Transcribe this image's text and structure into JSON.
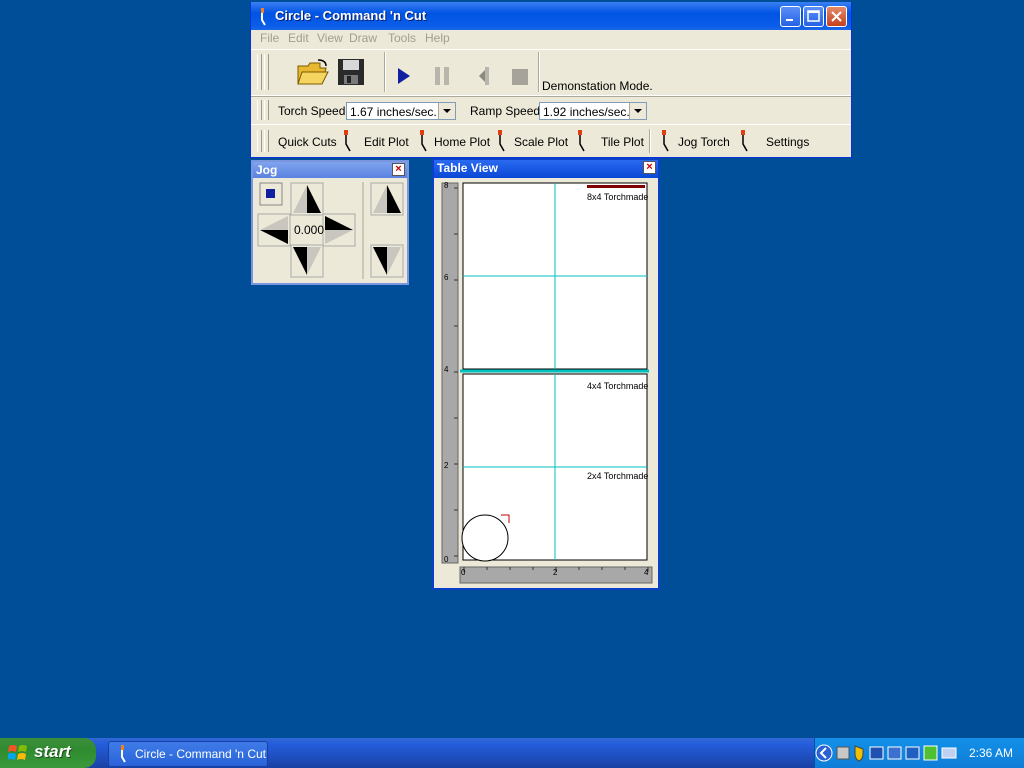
{
  "window": {
    "title": "Circle - Command 'n Cut"
  },
  "menu": [
    "File",
    "Edit",
    "View",
    "Draw",
    "Tools",
    "Help"
  ],
  "toolbar1": {
    "status_text": "Demonstation Mode.",
    "icons": [
      "open-folder-icon",
      "save-icon",
      "play-icon",
      "pause-icon",
      "step-back-icon",
      "stop-icon"
    ]
  },
  "toolbar2": {
    "torch_speed_label": "Torch Speed",
    "torch_speed_value": "1.67 inches/sec.",
    "ramp_speed_label": "Ramp Speed",
    "ramp_speed_value": "1.92 inches/sec."
  },
  "toolbar3": {
    "buttons": [
      "Quick Cuts",
      "Edit Plot",
      "Home Plot",
      "Scale Plot",
      "Tile Plot",
      "Jog Torch",
      "Settings"
    ]
  },
  "jog": {
    "title": "Jog",
    "value": "0.000"
  },
  "table_view": {
    "title": "Table View",
    "regions": [
      "8x4 Torchmade",
      "4x4 Torchmade",
      "2x4 Torchmade"
    ],
    "y_ticks": [
      "8",
      "6",
      "4",
      "2",
      "0"
    ],
    "x_ticks": [
      "0",
      "2",
      "4"
    ]
  },
  "taskbar": {
    "start_label": "start",
    "task_label": "Circle - Command 'n Cut",
    "clock": "2:36 AM"
  },
  "colors": {
    "desktop": "#004e98",
    "grid_line": "#00c0c0",
    "window_face": "#ece9d8"
  }
}
